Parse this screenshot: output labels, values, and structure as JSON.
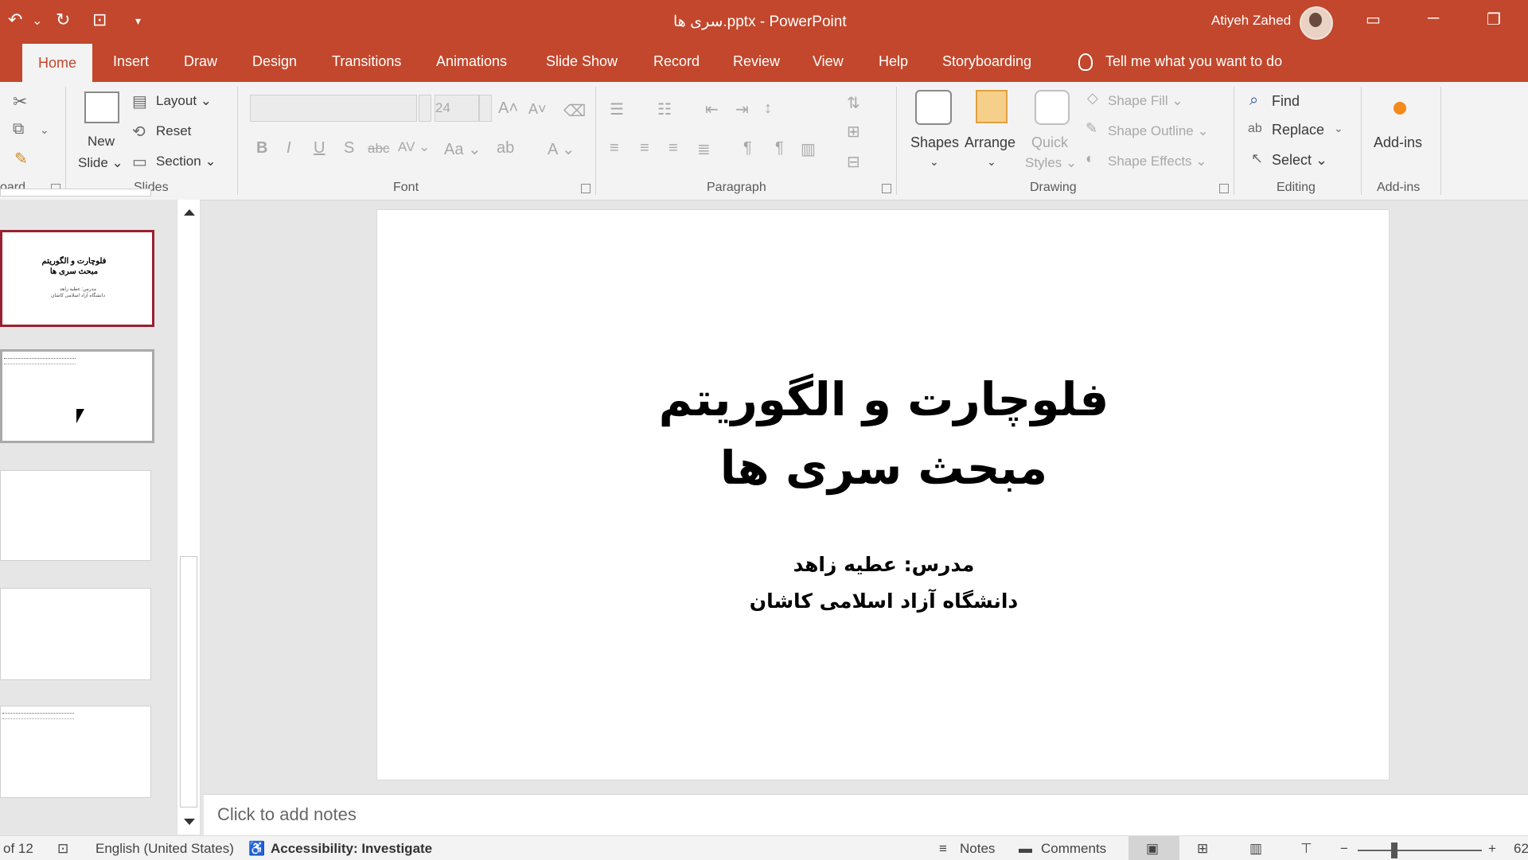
{
  "titlebar": {
    "undo": "↶",
    "undo_dd": "⌄",
    "redo": "↻",
    "present": "⊡",
    "customize": "▾",
    "title": "سری ها.pptx  -  PowerPoint",
    "user": "Atiyeh Zahed",
    "ribbon_display": "▭",
    "minimize": "─",
    "restore": "❐"
  },
  "tabs": [
    "Home",
    "Insert",
    "Draw",
    "Design",
    "Transitions",
    "Animations",
    "Slide Show",
    "Record",
    "Review",
    "View",
    "Help",
    "Storyboarding"
  ],
  "tellme": "Tell me what you want to do",
  "ribbon": {
    "clipboard_label": "oard",
    "slides": {
      "new_slide": "New",
      "new_slide2": "Slide ⌄",
      "layout": "Layout ⌄",
      "reset": "Reset",
      "section": "Section ⌄",
      "label": "Slides"
    },
    "font": {
      "size": "24",
      "label": "Font",
      "bold": "B",
      "italic": "I",
      "underline": "U",
      "shadow": "S",
      "strike": "abc",
      "spacing": "AV ⌄",
      "case": "Aa ⌄",
      "color": "A ⌄",
      "grow": "A˄",
      "shrink": "A˅"
    },
    "paragraph": {
      "label": "Paragraph"
    },
    "drawing": {
      "shapes": "Shapes",
      "arrange": "Arrange",
      "quick_styles": "Quick",
      "quick_styles2": "Styles ⌄",
      "shape_fill": "Shape Fill ⌄",
      "shape_outline": "Shape Outline ⌄",
      "shape_effects": "Shape Effects ⌄",
      "label": "Drawing"
    },
    "editing": {
      "find": "Find",
      "replace": "Replace",
      "select": "Select ⌄",
      "label": "Editing"
    },
    "addins": {
      "addins": "Add-ins",
      "label": "Add-ins"
    }
  },
  "thumbnails": [
    {
      "title": "فلوچارت و الگوریتم\nمبحث سری ها",
      "sub": "مدرس: عطیه زاهد\nدانشگاه آزاد اسلامی کاشان"
    }
  ],
  "slide": {
    "title_line1": "فلوچارت و الگوریتم",
    "title_line2": "مبحث سری ها",
    "sub_line1": "مدرس: عطیه زاهد",
    "sub_line2": "دانشگاه آزاد اسلامی کاشان"
  },
  "notes_placeholder": "Click to add notes",
  "status": {
    "slide_count": "of 12",
    "language": "English (United States)",
    "accessibility": "Accessibility: Investigate",
    "notes": "Notes",
    "comments": "Comments",
    "zoom_minus": "−",
    "zoom_plus": "+",
    "zoom_value": "62"
  }
}
